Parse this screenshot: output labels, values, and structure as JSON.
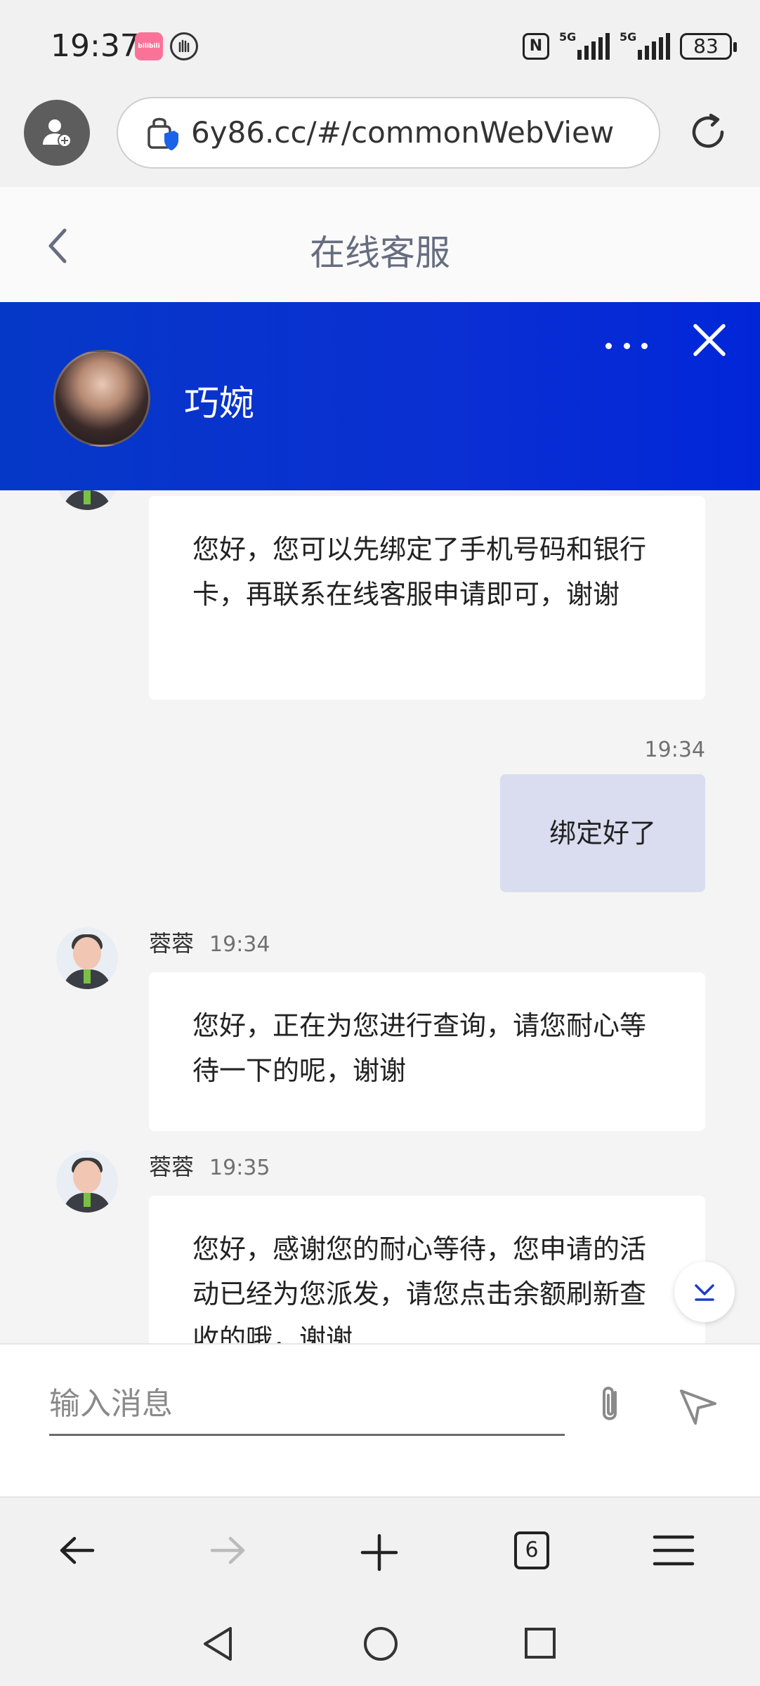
{
  "status_bar": {
    "time": "19:37",
    "nfc_label": "N",
    "signal1_label": "5G",
    "signal2_label": "5G",
    "battery": "83",
    "app_badge_label": "bilibili"
  },
  "browser": {
    "url": "6y86.cc/#/commonWebView",
    "tab_count": "6"
  },
  "page": {
    "title": "在线客服"
  },
  "chat_header": {
    "agent_name": "巧婉"
  },
  "messages": [
    {
      "direction": "in",
      "text": "您好，您可以先绑定了手机号码和银行卡，再联系在线客服申请即可，谢谢"
    },
    {
      "direction": "out",
      "time": "19:34",
      "text": "绑定好了"
    },
    {
      "direction": "in",
      "sender": "蓉蓉",
      "time": "19:34",
      "text": "您好，正在为您进行查询，请您耐心等待一下的呢，谢谢"
    },
    {
      "direction": "in",
      "sender": "蓉蓉",
      "time": "19:35",
      "text": "您好，感谢您的耐心等待，您申请的活动已经为您派发，请您点击余额刷新查收的哦，谢谢"
    }
  ],
  "input": {
    "placeholder": "输入消息"
  }
}
